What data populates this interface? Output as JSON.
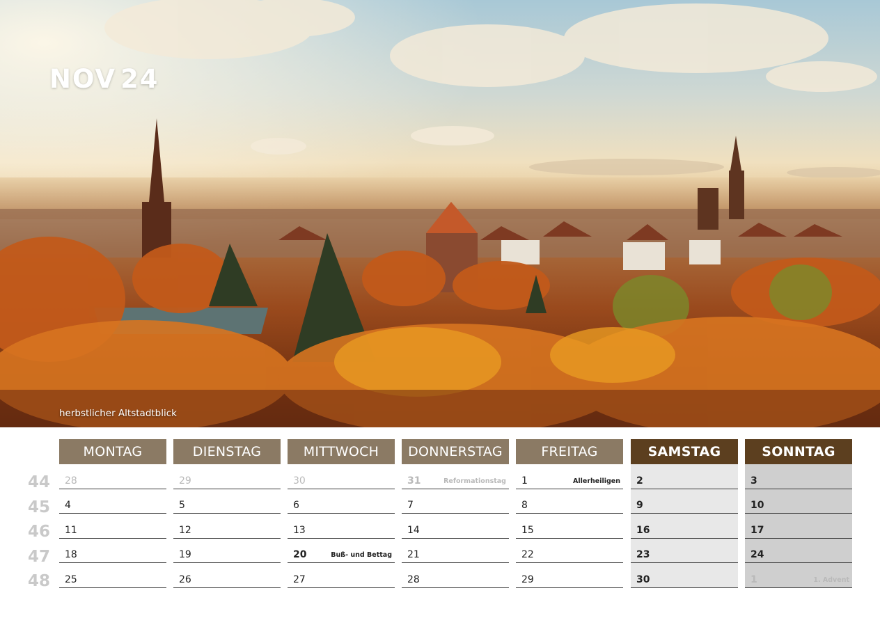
{
  "header": {
    "month": "NOV",
    "year": "24"
  },
  "photo": {
    "caption": "herbstlicher Altstadtblick"
  },
  "days": [
    "MONTAG",
    "DIENSTAG",
    "MITTWOCH",
    "DONNERSTAG",
    "FREITAG",
    "SAMSTAG",
    "SONNTAG"
  ],
  "weeks": [
    "44",
    "45",
    "46",
    "47",
    "48"
  ],
  "grid": [
    [
      {
        "n": "28",
        "muted": true
      },
      {
        "n": "29",
        "muted": true
      },
      {
        "n": "30",
        "muted": true
      },
      {
        "n": "31",
        "muted": true,
        "bold": true,
        "holiday": "Reformationstag"
      },
      {
        "n": "1",
        "holiday": "Allerheiligen"
      },
      {
        "n": "2",
        "bold": true
      },
      {
        "n": "3",
        "bold": true
      }
    ],
    [
      {
        "n": "4"
      },
      {
        "n": "5"
      },
      {
        "n": "6"
      },
      {
        "n": "7"
      },
      {
        "n": "8"
      },
      {
        "n": "9",
        "bold": true
      },
      {
        "n": "10",
        "bold": true
      }
    ],
    [
      {
        "n": "11"
      },
      {
        "n": "12"
      },
      {
        "n": "13"
      },
      {
        "n": "14"
      },
      {
        "n": "15"
      },
      {
        "n": "16",
        "bold": true
      },
      {
        "n": "17",
        "bold": true
      }
    ],
    [
      {
        "n": "18"
      },
      {
        "n": "19"
      },
      {
        "n": "20",
        "bold": true,
        "holiday": "Buß- und Bettag"
      },
      {
        "n": "21"
      },
      {
        "n": "22"
      },
      {
        "n": "23",
        "bold": true
      },
      {
        "n": "24",
        "bold": true
      }
    ],
    [
      {
        "n": "25"
      },
      {
        "n": "26"
      },
      {
        "n": "27"
      },
      {
        "n": "28"
      },
      {
        "n": "29"
      },
      {
        "n": "30",
        "bold": true
      },
      {
        "n": "1",
        "muted": true,
        "bold": true,
        "holiday": "1. Advent"
      }
    ]
  ],
  "colors": {
    "weekday_header": "#8b7a64",
    "weekend_header": "#5c3f1f",
    "saturday_bg": "#e8e8e8",
    "sunday_bg": "#cfcfcf"
  }
}
